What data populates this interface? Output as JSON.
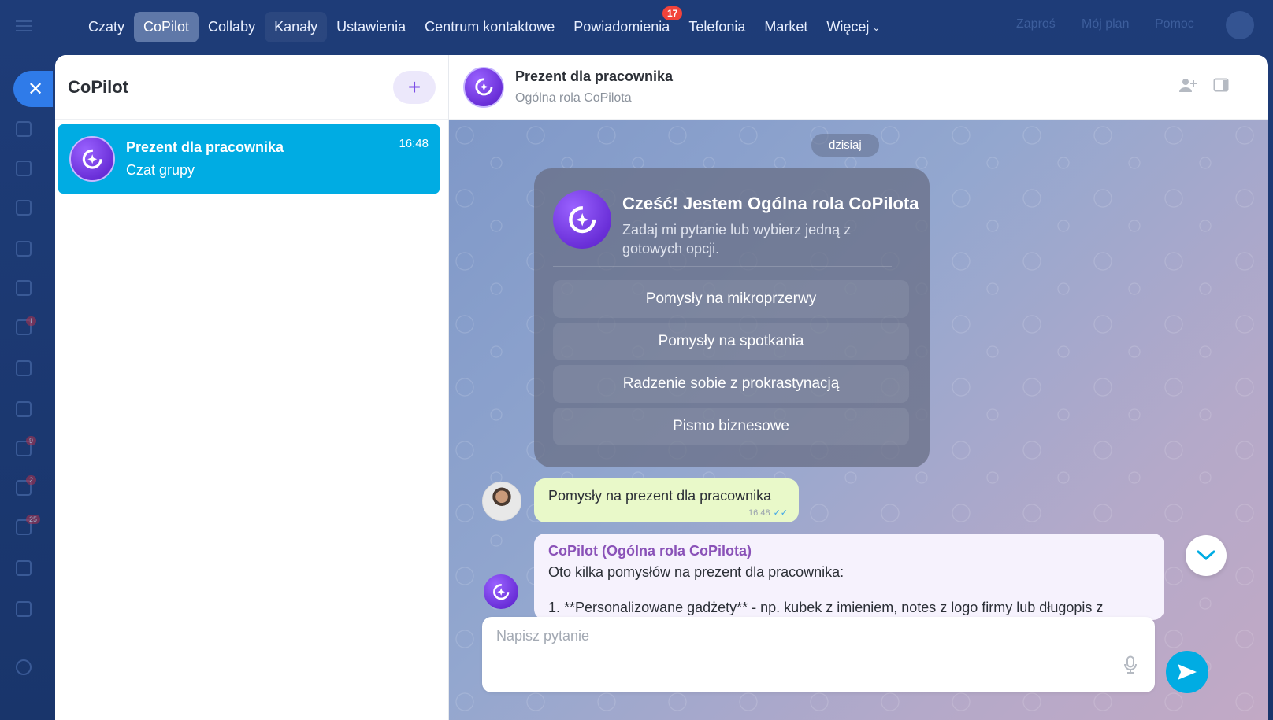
{
  "top_nav": {
    "items": [
      {
        "label": "Czaty"
      },
      {
        "label": "CoPilot"
      },
      {
        "label": "Collaby"
      },
      {
        "label": "Kanały"
      },
      {
        "label": "Ustawienia"
      },
      {
        "label": "Centrum kontaktowe"
      },
      {
        "label": "Powiadomienia",
        "badge": "17"
      },
      {
        "label": "Telefonia"
      },
      {
        "label": "Market"
      },
      {
        "label": "Więcej"
      }
    ],
    "active": "CoPilot"
  },
  "background": {
    "right_links": [
      "Zaproś",
      "Mój plan",
      "Pomoc"
    ],
    "rail_badges": [
      "1",
      "9",
      "2",
      "25"
    ]
  },
  "sidebar": {
    "title": "CoPilot",
    "add_icon": "plus-icon",
    "chats": [
      {
        "name": "Prezent dla pracownika",
        "subtitle": "Czat grupy",
        "time": "16:48"
      }
    ]
  },
  "conversation": {
    "title": "Prezent dla pracownika",
    "subtitle": "Ogólna rola CoPilota",
    "date_label": "dzisiaj",
    "welcome": {
      "title": "Cześć! Jestem Ogólna rola CoPilota",
      "subtitle": "Zadaj mi pytanie lub wybierz jedną z gotowych opcji.",
      "options": [
        "Pomysły na mikroprzerwy",
        "Pomysły na spotkania",
        "Radzenie sobie z prokrastynacją",
        "Pismo biznesowe"
      ]
    },
    "user_message": {
      "text": "Pomysły na prezent dla pracownika",
      "time": "16:48"
    },
    "bot_message": {
      "author": "CoPilot (Ogólna rola CoPilota)",
      "line1": "Oto kilka pomysłów na prezent dla pracownika:",
      "line2": "1. **Personalizowane gadżety** - np. kubek z imieniem, notes z logo firmy lub długopis z"
    },
    "composer": {
      "placeholder": "Napisz pytanie"
    }
  },
  "colors": {
    "accent": "#00ace3",
    "copilot_purple": "#6a2fd8",
    "badge_red": "#f2433b"
  }
}
